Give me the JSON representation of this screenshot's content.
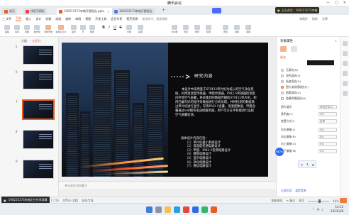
{
  "meeting": {
    "title": "腾讯会议",
    "controls": [
      "—",
      "□",
      "✕"
    ]
  },
  "tabs": [
    {
      "label": "首页",
      "color": "#e95d1e"
    },
    {
      "label": "找稻壳模板",
      "color": "#e8453c"
    },
    {
      "label": "190223173李楠开题报告.pptx",
      "color": "#e95d1e"
    },
    {
      "label": "190223173李楠开题报告",
      "color": "#4a7de8"
    }
  ],
  "tab_add": "+",
  "self_badge": "正在讲话：190223173李楠",
  "menu": {
    "items": [
      "三 文件",
      "开始",
      "插入",
      "设计",
      "切换",
      "动画",
      "放映",
      "审阅",
      "视图",
      "开发工具",
      "会员专享",
      "稻壳资源"
    ],
    "active_index": 1,
    "search": "查找命令、搜索模板",
    "right_items": [
      "未同步",
      "协作",
      "分享"
    ]
  },
  "ribbon": {
    "buttons": [
      "粘贴",
      "剪切",
      "复制",
      "格式刷",
      "当前开始",
      "新建幻灯片",
      "版式",
      "节",
      "重置",
      "B",
      "I",
      "U",
      "S",
      "字体",
      "段落",
      "文本框",
      "形状",
      "排列",
      "轮廓",
      "查找",
      "替换",
      "选择"
    ]
  },
  "left_panel": {
    "tabs": [
      "大纲",
      "幻灯片"
    ],
    "slides": [
      {
        "num": "5",
        "active": false
      },
      {
        "num": "6",
        "active": false
      },
      {
        "num": "7",
        "active": true
      },
      {
        "num": "8",
        "active": false
      },
      {
        "num": "9",
        "active": false
      }
    ]
  },
  "slide": {
    "title": "研究内容",
    "body": "本设计中采用基于STM32单片机为核心的空气净化系统，利用温湿度传感器、甲醛传感器、PM2.5传感器检测室内环境空气质量，将采集到的数据传输给STM32单片机，利用已编写好的程序对数据进行分析处理，并将检测的数据通过单片机进行显示，可将PM2.5含量、温湿度数值、甲醛含量通过wifi模块发送给服务器，用戶可以在手机端进行远程空气质量监测。",
    "list_title": "具体设计内容包括：",
    "list_items": [
      "（1）单片机最小系统设计",
      "（2）温湿度检测电路设计",
      "（3）甲醛、PM2.5检测电路设计",
      "（4）键盘电路设计",
      "（5）显示电路设计",
      "（6）净化电路设计",
      "（7）通信电路设计"
    ]
  },
  "notes_placeholder": "单击此处添加备注",
  "right_panel": {
    "title": "对象属性",
    "close": "✕",
    "section_fill": "填充",
    "fill_options": [
      "无填充(N)",
      "纯色填充(S)",
      "渐变填充(G)",
      "图片或纹理填充(P)",
      "图案填充(A)",
      "隐藏背景图形(H)"
    ],
    "fill_selected": 3,
    "image_fill_label": "图片填充",
    "image_fill_value": "本地文件(L)",
    "transparency_label": "透明度(T)",
    "transparency_value": "0%",
    "tile_label": "放置方式(I)",
    "tile_value": "拉伸",
    "offsets": [
      {
        "label": "向左偏移(L)",
        "value": "0%"
      },
      {
        "label": "向右偏移(R)",
        "value": "0%"
      },
      {
        "label": "向上偏移(O)",
        "value": "0%"
      },
      {
        "label": "向下偏移(M)",
        "value": "0%"
      }
    ],
    "bottom_links": [
      "全部应用",
      "重置背景"
    ],
    "orb_label": "062%",
    "card_icons": [
      "☁",
      "⬇",
      "▲"
    ]
  },
  "statusbar": {
    "left": [
      "幻灯片 7 / 16",
      "Office 主题",
      "缺失字体"
    ],
    "right": [
      "智能美化",
      "≡ 备注",
      "批注",
      "48%"
    ]
  },
  "share_notice": "190223173李楠正在共享屏幕",
  "taskbar": {
    "icons": [
      {
        "name": "start-icon",
        "color": "#3b7ddd"
      },
      {
        "name": "search-icon",
        "color": "#8a94a6"
      },
      {
        "name": "folder-icon",
        "color": "#f2c14e"
      },
      {
        "name": "edge-icon",
        "color": "#2c9ee8"
      },
      {
        "name": "wps-icon",
        "color": "#e8453c"
      },
      {
        "name": "meeting-icon",
        "color": "#2f6be8"
      },
      {
        "name": "chat-icon",
        "color": "#38b36b"
      },
      {
        "name": "ppt-icon",
        "color": "#e95d1e"
      }
    ],
    "tray": [
      "^",
      "中",
      "♪"
    ],
    "time": "14:32",
    "date": "2023/3/8"
  }
}
